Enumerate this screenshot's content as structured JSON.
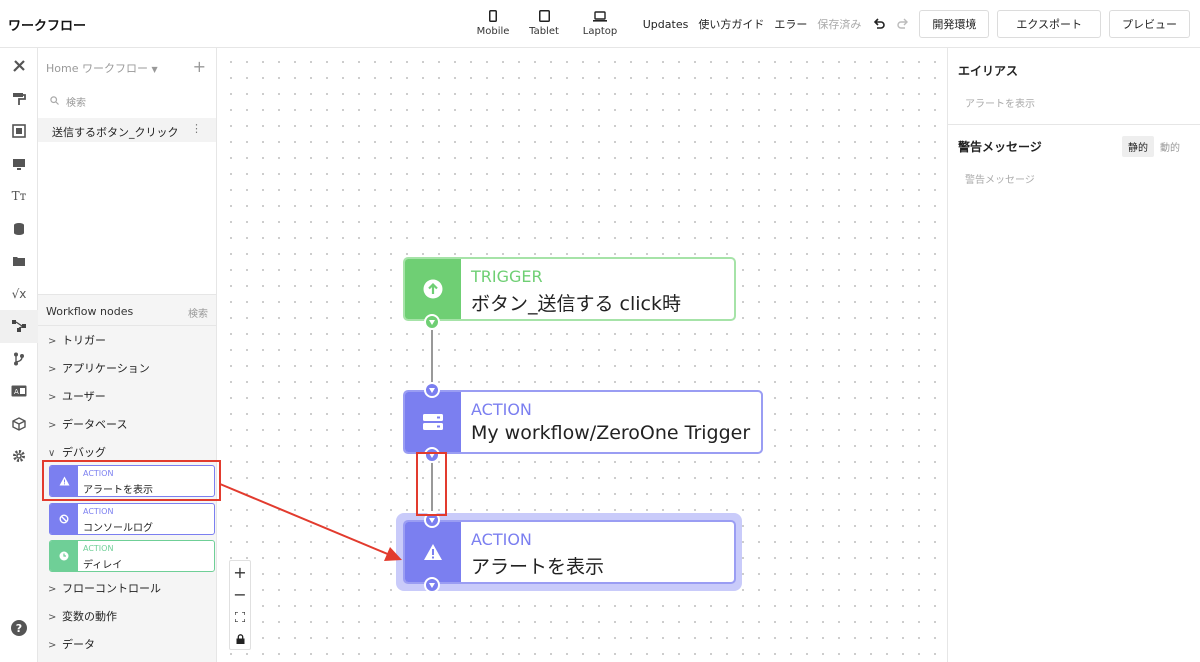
{
  "app": {
    "title": "ワークフロー"
  },
  "devices": [
    {
      "label": "Mobile",
      "icon": "mobile-icon"
    },
    {
      "label": "Tablet",
      "icon": "tablet-icon"
    },
    {
      "label": "Laptop",
      "icon": "laptop-icon"
    }
  ],
  "topbar": {
    "updates": "Updates",
    "guide": "使い方ガイド",
    "errors": "エラー",
    "saved": "保存済み",
    "dev_env": "開発環境",
    "export": "エクスポート",
    "preview": "プレビュー"
  },
  "rail": {
    "icons": [
      "tools-icon",
      "paint-roller-icon",
      "layout-icon",
      "monitor-icon",
      "text-icon",
      "database-icon",
      "folder-icon",
      "formula-icon",
      "workflow-icon",
      "branch-icon",
      "id-card-icon",
      "cube-icon",
      "gear-icon"
    ],
    "help": "?"
  },
  "left_panel": {
    "workflow_select": "Home ワークフロー",
    "add": "+",
    "search_placeholder": "検索",
    "workflows": [
      {
        "name": "送信するボタン_クリック",
        "menu": "⋮"
      }
    ],
    "nodes_title": "Workflow nodes",
    "nodes_search": "検索",
    "categories": [
      {
        "label": "トリガー",
        "expanded": false
      },
      {
        "label": "アプリケーション",
        "expanded": false
      },
      {
        "label": "ユーザー",
        "expanded": false
      },
      {
        "label": "データベース",
        "expanded": false
      },
      {
        "label": "デバッグ",
        "expanded": true
      },
      {
        "label": "フローコントロール",
        "expanded": false
      },
      {
        "label": "変数の動作",
        "expanded": false
      },
      {
        "label": "データ",
        "expanded": false
      }
    ],
    "debug_nodes": [
      {
        "kind": "ACTION",
        "name": "アラートを表示",
        "color": "#7b7ff0",
        "icon": "warning-icon"
      },
      {
        "kind": "ACTION",
        "name": "コンソールログ",
        "color": "#7b7ff0",
        "icon": "ban-icon"
      },
      {
        "kind": "ACTION",
        "name": "ディレイ",
        "color": "#6fcf97",
        "icon": "clock-icon"
      }
    ]
  },
  "canvas": {
    "nodes": [
      {
        "kind": "TRIGGER",
        "name": "ボタン_送信する click時",
        "color": "#6fcf74",
        "icon": "arrow-up-circle-icon"
      },
      {
        "kind": "ACTION",
        "name": "My workflow/ZeroOne Trigger",
        "color": "#7b7ff0",
        "icon": "server-icon"
      },
      {
        "kind": "ACTION",
        "name": "アラートを表示",
        "color": "#7b7ff0",
        "icon": "warning-icon"
      }
    ],
    "zoom_controls": [
      "+",
      "−",
      "fit-icon",
      "lock-icon"
    ],
    "annotation_color": "#e23b2e"
  },
  "right_panel": {
    "alias_title": "エイリアス",
    "alias_placeholder": "アラートを表示",
    "message_title": "警告メッセージ",
    "static_label": "静的",
    "dynamic_label": "動的",
    "message_placeholder": "警告メッセージ"
  }
}
